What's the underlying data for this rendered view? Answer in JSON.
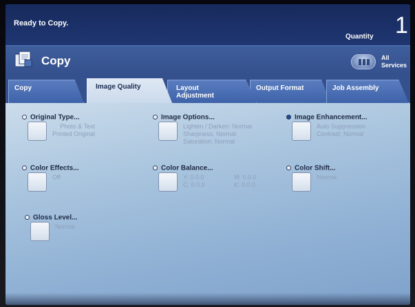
{
  "status": {
    "text": "Ready to Copy.",
    "quantity_label": "Quantity",
    "quantity_value": "1"
  },
  "header": {
    "title": "Copy",
    "icon": "copy-icon",
    "all_services_label": "All Services",
    "all_services_icon": "services-icon"
  },
  "tabs": [
    {
      "label": "Copy",
      "active": false
    },
    {
      "label": "Image Quality",
      "active": true
    },
    {
      "label": "Layout Adjustment",
      "active": false
    },
    {
      "label": "Output Format",
      "active": false
    },
    {
      "label": "Job Assembly",
      "active": false
    }
  ],
  "options": {
    "original_type": {
      "title": "Original Type...",
      "line1": "Photo & Text",
      "line2": "Printed Original"
    },
    "image_options": {
      "title": "Image Options...",
      "line1": "Lighten / Darken: Normal",
      "line2": "Sharpness: Normal",
      "line3": "Saturation: Normal"
    },
    "image_enhancement": {
      "title": "Image Enhancement...",
      "line1": "Auto Suppression",
      "line2": "Contrast: Normal",
      "selected": true
    },
    "color_effects": {
      "title": "Color Effects...",
      "line1": "Off"
    },
    "color_balance": {
      "title": "Color Balance...",
      "y": "Y: 0.0.0",
      "m": "M: 0.0.0",
      "c": "C: 0.0.0",
      "k": "K: 0.0.0"
    },
    "color_shift": {
      "title": "Color Shift...",
      "line1": "Normal"
    },
    "gloss_level": {
      "title": "Gloss Level...",
      "line1": "Normal"
    }
  },
  "colors": {
    "screen_background": "#1d2f5e",
    "panel_light": "#cbdceb",
    "panel_dark": "#7fa2cb",
    "tab_active": "#dfe8f4",
    "tab_inactive": "#3e62a8"
  }
}
